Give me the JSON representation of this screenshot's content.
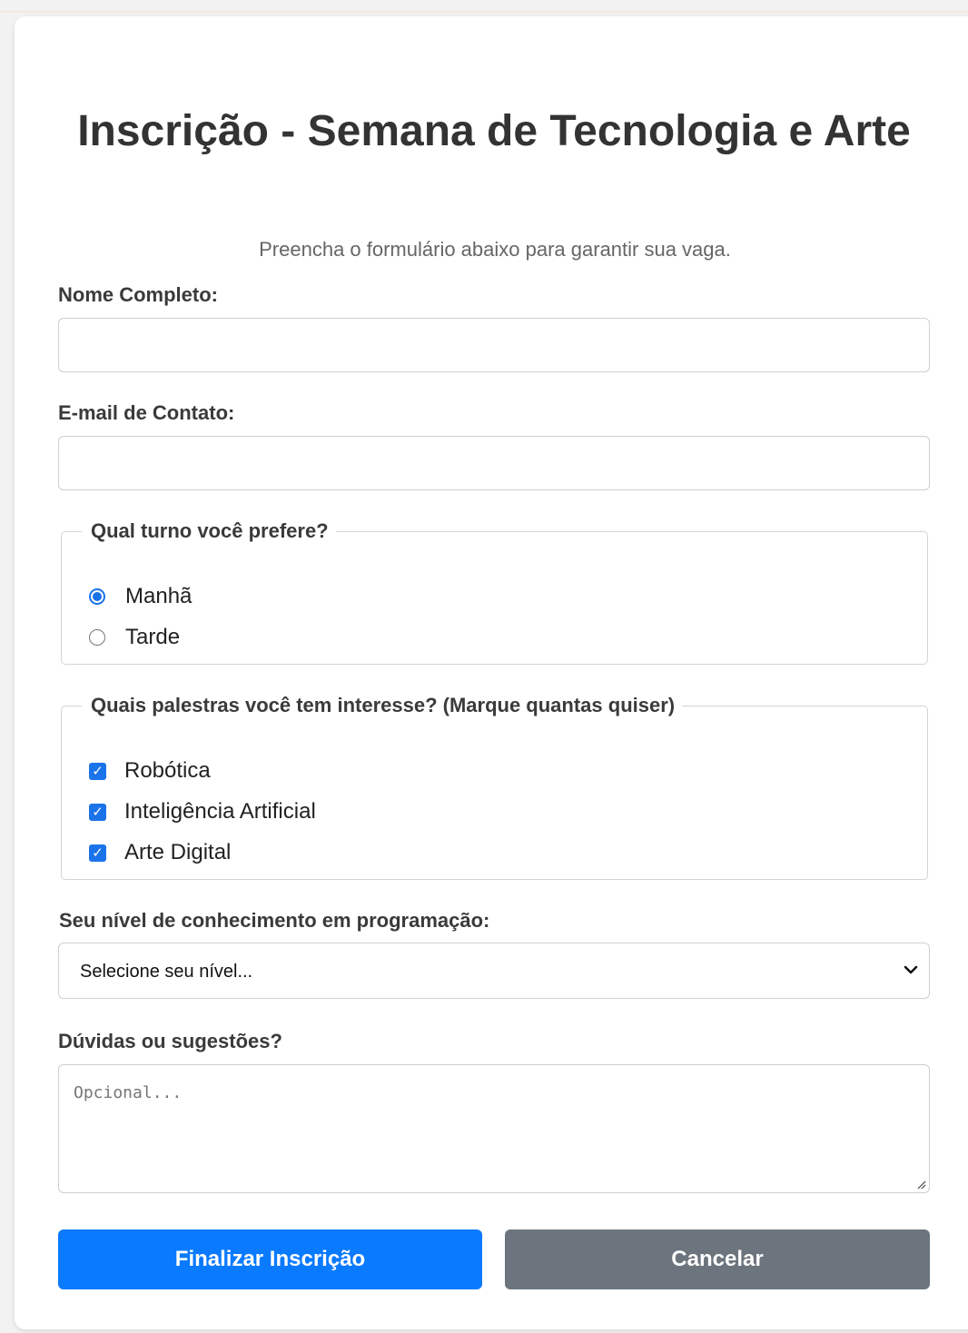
{
  "form": {
    "title": "Inscrição - Semana de Tecnologia e Arte",
    "subtitle": "Preencha o formulário abaixo para garantir sua vaga.",
    "name_label": "Nome Completo:",
    "name_value": "",
    "email_label": "E-mail de Contato:",
    "email_value": "",
    "shift": {
      "legend": "Qual turno você prefere?",
      "options": [
        {
          "label": "Manhã",
          "selected": true
        },
        {
          "label": "Tarde",
          "selected": false
        }
      ]
    },
    "talks": {
      "legend": "Quais palestras você tem interesse? (Marque quantas quiser)",
      "options": [
        {
          "label": "Robótica",
          "checked": true
        },
        {
          "label": "Inteligência Artificial",
          "checked": true
        },
        {
          "label": "Arte Digital",
          "checked": true
        }
      ]
    },
    "level_label": "Seu nível de conhecimento em programação:",
    "level_selected": "Selecione seu nível...",
    "comments_label": "Dúvidas ou sugestões?",
    "comments_placeholder": "Opcional...",
    "submit_label": "Finalizar Inscrição",
    "cancel_label": "Cancelar"
  },
  "colors": {
    "primary": "#0a7aff",
    "secondary": "#6c757d",
    "accent": "#1a73e8"
  }
}
